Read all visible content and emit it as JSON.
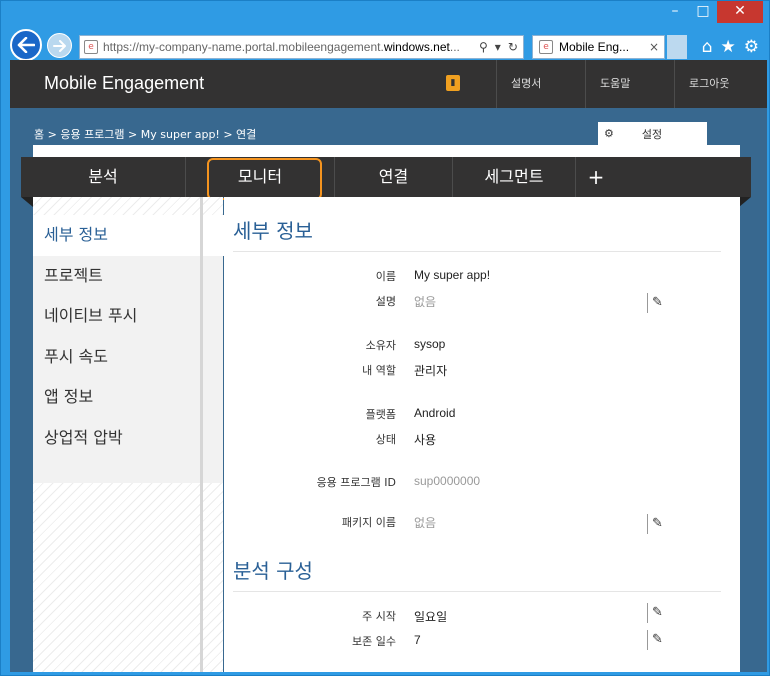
{
  "browser": {
    "window_controls": {
      "minimize": "–",
      "maximize": "□",
      "close": "✕"
    },
    "url_gray": "https://my-company-name.portal.mobileengagement.",
    "url_dark": "windows.net",
    "url_ellipsis": "...",
    "tab_title": "Mobile Eng...",
    "tab_close": "×",
    "address_icons": {
      "search": "⚲",
      "dropdown": "▾",
      "refresh": "↻"
    },
    "toolbar_icons": {
      "home": "⌂",
      "favorites": "★",
      "tools": "⚙"
    }
  },
  "app": {
    "title": "Mobile Engagement",
    "links": [
      "설명서",
      "도움말",
      "로그아웃"
    ]
  },
  "breadcrumb": "홈 > 응용 프로그램 > My super app! > 연결",
  "settings_tab": "설정",
  "nav": {
    "items": [
      "분석",
      "모니터",
      "연결",
      "세그먼트",
      "+"
    ],
    "highlighted_index": 1
  },
  "sidebar": {
    "items": [
      "세부 정보",
      "프로젝트",
      "네이티브 푸시",
      "푸시 속도",
      "앱 정보",
      "상업적 압박"
    ],
    "active_index": 0
  },
  "content": {
    "section1_title": "세부 정보",
    "section2_title": "분석 구성",
    "fields": {
      "name": {
        "label": "이름",
        "value": "My super app!"
      },
      "description": {
        "label": "설명",
        "value": "없음"
      },
      "owner": {
        "label": "소유자",
        "value": "sysop"
      },
      "my_role": {
        "label": "내 역할",
        "value": "관리자"
      },
      "platform": {
        "label": "플랫폼",
        "value": "Android"
      },
      "status": {
        "label": "상태",
        "value": "사용"
      },
      "app_id": {
        "label": "응용 프로그램 ID",
        "value": "sup0000000"
      },
      "package_name": {
        "label": "패키지 이름",
        "value": "없음"
      },
      "week_start": {
        "label": "주 시작",
        "value": "일요일"
      },
      "retention_days": {
        "label": "보존 일수",
        "value": "7"
      }
    },
    "edit_icon": "✎"
  }
}
